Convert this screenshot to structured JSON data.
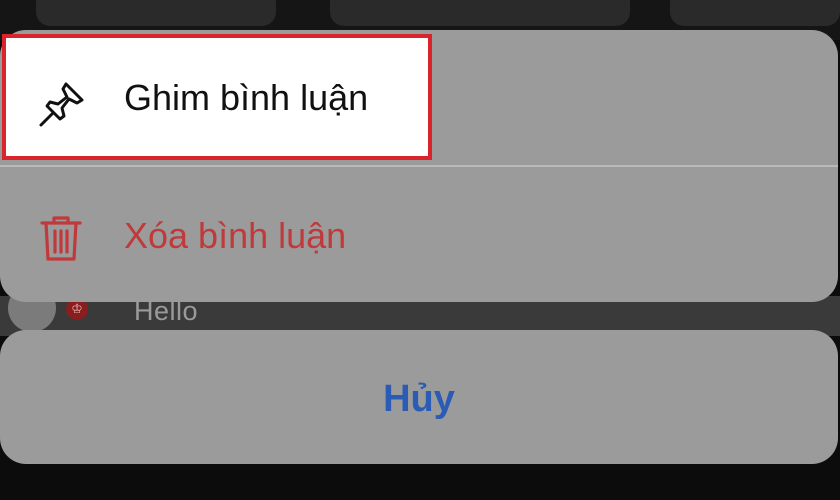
{
  "background": {
    "comment_text": "Hello",
    "badge_symbol": "♔"
  },
  "sheet": {
    "pin_label": "Ghim bình luận",
    "pin_icon": "pin-icon",
    "delete_label": "Xóa bình luận",
    "delete_icon": "trash-icon",
    "cancel_label": "Hủy"
  },
  "colors": {
    "highlight_border": "#d9242b",
    "delete_text": "#c0393b",
    "cancel_text": "#2a5bb5",
    "sheet_background": "#9b9b9b"
  }
}
